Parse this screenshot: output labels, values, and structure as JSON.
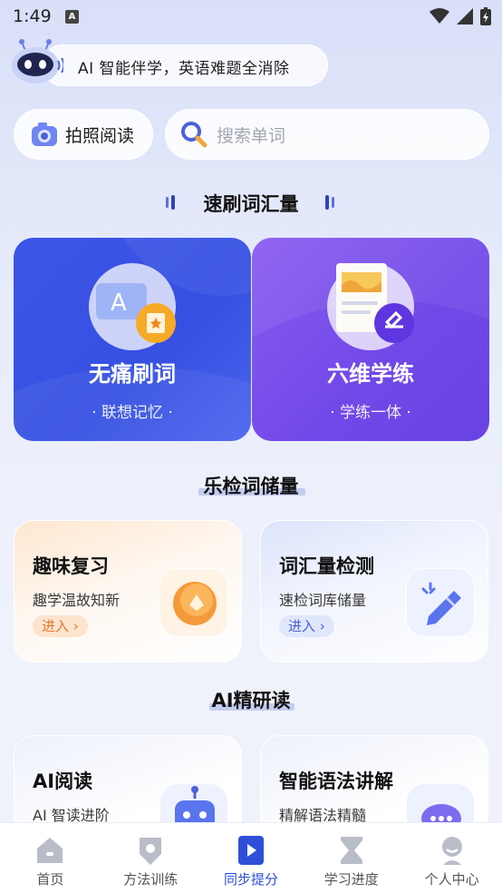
{
  "status_bar": {
    "time": "1:49",
    "notif_letter": "A"
  },
  "banner": {
    "text": "AI 智能伴学，英语难题全消除"
  },
  "actions": {
    "photo_label": "拍照阅读",
    "search_placeholder": "搜索单词"
  },
  "sections": {
    "vocab": "速刷词汇量",
    "reserve": "乐检词储量",
    "reading": "AI精研读"
  },
  "big_cards": [
    {
      "title": "无痛刷词",
      "subtitle": "· 联想记忆 ·",
      "color": "#3d55e6",
      "icon": "flashcard-icon"
    },
    {
      "title": "六维学练",
      "subtitle": "· 学练一体 ·",
      "color": "#7a50ec",
      "icon": "document-pen-icon"
    }
  ],
  "mid_cards": [
    {
      "title": "趣味复习",
      "subtitle": "趣学温故知新",
      "enter": "进入",
      "icon": "review-coin-icon",
      "accent": "#e87a2c"
    },
    {
      "title": "词汇量检测",
      "subtitle": "速检词库储量",
      "enter": "进入",
      "icon": "pencil-check-icon",
      "accent": "#4a62d8"
    }
  ],
  "low_cards": [
    {
      "title": "AI阅读",
      "subtitle": "AI 智读进阶",
      "icon": "robot-icon"
    },
    {
      "title": "智能语法讲解",
      "subtitle": "精解语法精髓",
      "icon": "chat-bubble-icon"
    }
  ],
  "tabs": [
    {
      "label": "首页",
      "icon": "home-icon",
      "active": false
    },
    {
      "label": "方法训练",
      "icon": "badge-icon",
      "active": false
    },
    {
      "label": "同步提分",
      "icon": "book-play-icon",
      "active": true
    },
    {
      "label": "学习进度",
      "icon": "hourglass-icon",
      "active": false
    },
    {
      "label": "个人中心",
      "icon": "person-icon",
      "active": false
    }
  ],
  "colors": {
    "accent": "#2f4fd8",
    "background": "#e6ebfa"
  }
}
